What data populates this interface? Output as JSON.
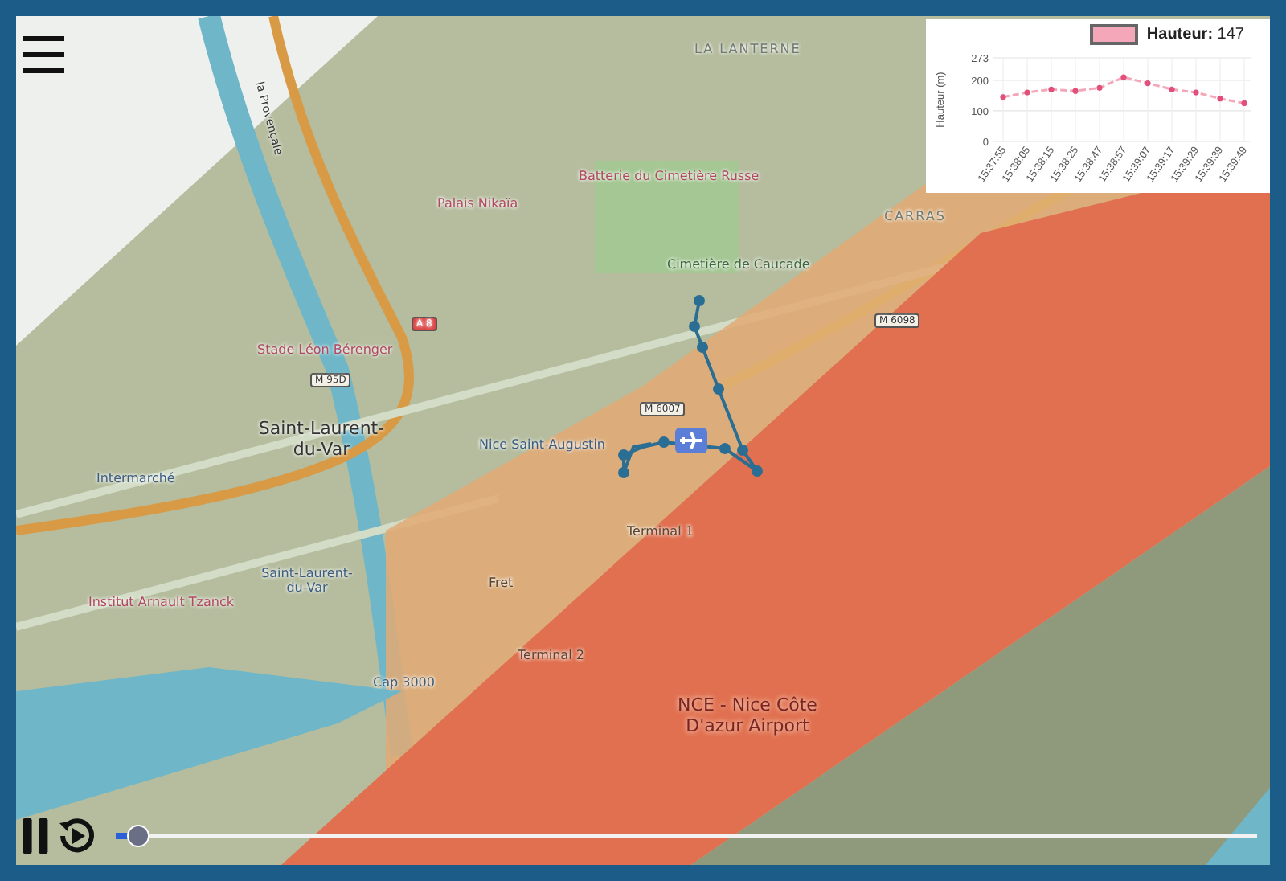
{
  "map": {
    "labels": [
      {
        "text": "LA LANTERNE",
        "kind": "district"
      },
      {
        "text": "Batterie du Cimetière Russe",
        "kind": "poi"
      },
      {
        "text": "Palais Nikaïa",
        "kind": "poi"
      },
      {
        "text": "Cimetière de Caucade",
        "kind": "park"
      },
      {
        "text": "CARRAS",
        "kind": "district"
      },
      {
        "text": "la Provençale",
        "kind": "road"
      },
      {
        "text": "A 8",
        "kind": "shield"
      },
      {
        "text": "Stade Léon Bérenger",
        "kind": "poi"
      },
      {
        "text": "M 95D",
        "kind": "shield"
      },
      {
        "text": "M 6098",
        "kind": "shield"
      },
      {
        "text": "M 6007",
        "kind": "shield"
      },
      {
        "text": "Saint-Laurent-du-Var",
        "kind": "town"
      },
      {
        "text": "Nice Saint-Augustin",
        "kind": "transit"
      },
      {
        "text": "Intermarché",
        "kind": "transit"
      },
      {
        "text": "Terminal 1",
        "kind": "airport"
      },
      {
        "text": "Saint-Laurent-du-Var",
        "kind": "station"
      },
      {
        "text": "Institut Arnault Tzanck",
        "kind": "poi"
      },
      {
        "text": "Fret",
        "kind": "airport"
      },
      {
        "text": "Terminal 2",
        "kind": "airport"
      },
      {
        "text": "Cap 3000",
        "kind": "transit"
      },
      {
        "text": "NCE - Nice Côte D'azur Airport",
        "kind": "airport-main"
      }
    ]
  },
  "chart": {
    "legend": {
      "separator": ":",
      "value": "147"
    },
    "chart_data": {
      "type": "line",
      "grid": true,
      "ylabel": "Hauteur (m)",
      "categories": [
        "15:37:55",
        "15:38:05",
        "15:38:15",
        "15:38:25",
        "15:38:47",
        "15:38:57",
        "15:39:07",
        "15:39:17",
        "15:39:29",
        "15:39:39",
        "15:39:49"
      ],
      "series": [
        {
          "name": "Hauteur",
          "color": "#f4a7b9",
          "line_style": "dashed",
          "marker": "circle",
          "values": [
            145,
            160,
            170,
            165,
            175,
            210,
            190,
            170,
            160,
            140,
            125
          ]
        }
      ],
      "ylim": [
        0,
        273
      ],
      "yticks": [
        0,
        100,
        200,
        273
      ]
    }
  },
  "player": {
    "playing": true,
    "level": 0.02
  }
}
